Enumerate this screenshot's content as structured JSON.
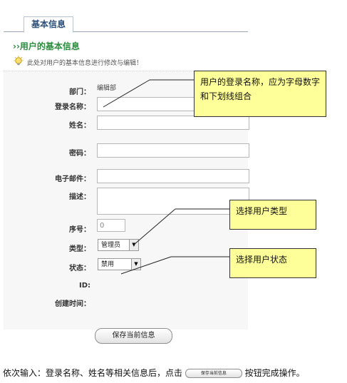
{
  "tab": {
    "label": "基本信息"
  },
  "section_title": "››用户的基本信息",
  "hint": {
    "text": "此处对用户的基本信息进行修改与编辑！"
  },
  "form": {
    "department": {
      "label": "部门：",
      "value": "编辑部"
    },
    "login_name": {
      "label": "登录名称：",
      "value": ""
    },
    "name": {
      "label": "姓名：",
      "value": ""
    },
    "password": {
      "label": "密码：",
      "value": ""
    },
    "email": {
      "label": "电子邮件：",
      "value": ""
    },
    "description": {
      "label": "描述：",
      "value": ""
    },
    "order": {
      "label": "序号：",
      "value": "0"
    },
    "type": {
      "label": "类型：",
      "selected": "管理员"
    },
    "status": {
      "label": "状态：",
      "selected": "禁用"
    },
    "id": {
      "label": "ID:",
      "value": ""
    },
    "created_time": {
      "label": "创建时间：",
      "value": ""
    }
  },
  "save_button": {
    "label": "保存当前信息"
  },
  "callouts": {
    "login_name": "用户的登录名称，应为字母数字和下划线组合",
    "type": "选择用户类型",
    "status": "选择用户状态"
  },
  "instruction": {
    "before": "依次输入：登录名称、姓名等相关信息后，点击",
    "button_label": "保存当前信息",
    "after": "按钮完成操作。"
  },
  "colors": {
    "title_green": "#2a8c3c",
    "tab_text": "#2b4e7a",
    "callout_bg": "#ffff99"
  }
}
